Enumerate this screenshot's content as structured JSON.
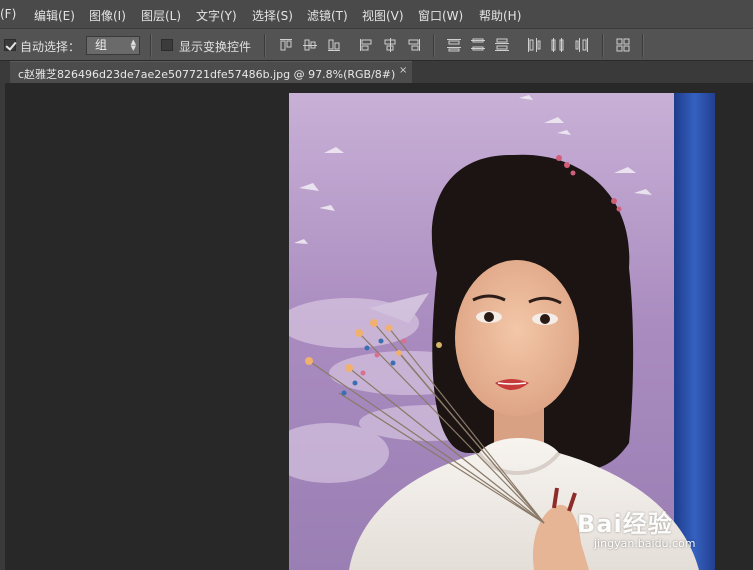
{
  "menu": {
    "items": [
      "(F)",
      "编辑(E)",
      "图像(I)",
      "图层(L)",
      "文字(Y)",
      "选择(S)",
      "滤镜(T)",
      "视图(V)",
      "窗口(W)",
      "帮助(H)"
    ]
  },
  "options": {
    "auto_select_label": "自动选择：",
    "auto_select_checked": true,
    "auto_select_value": "组",
    "show_transform_label": "显示变换控件",
    "show_transform_checked": false
  },
  "document": {
    "tab_title": "c赵雅芝826496d23de7ae2e507721dfe57486b.jpg @ 97.8%(RGB/8#)",
    "close_glyph": "×"
  },
  "watermark": {
    "logo_text": "Bai经验",
    "url": "jingyan.baidu.com"
  },
  "colors": {
    "menubar": "#4a4a4a",
    "optbar": "#535353",
    "workspace": "#282828",
    "photo_background": "#b89cc4",
    "photo_curtain": "#2a4fa8"
  }
}
